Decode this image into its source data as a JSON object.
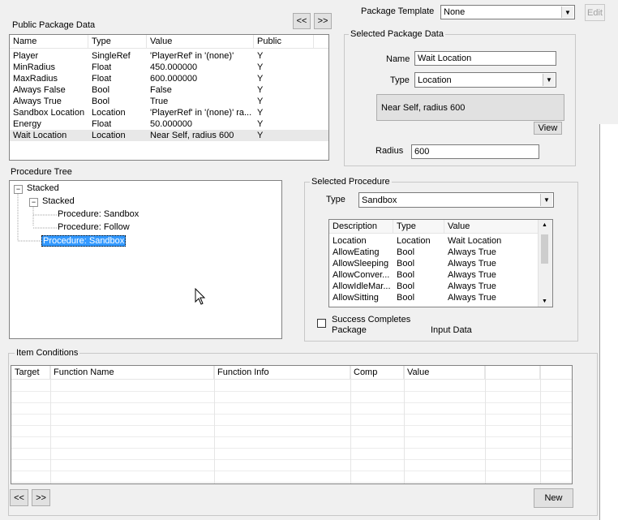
{
  "public_package": {
    "title": "Public Package Data",
    "nav_prev": "<<",
    "nav_next": ">>",
    "columns": [
      "Name",
      "Type",
      "Value",
      "Public"
    ],
    "rows": [
      [
        "Player",
        "SingleRef",
        "'PlayerRef' in '(none)'",
        "Y"
      ],
      [
        "MinRadius",
        "Float",
        "450.000000",
        "Y"
      ],
      [
        "MaxRadius",
        "Float",
        "600.000000",
        "Y"
      ],
      [
        "Always False",
        "Bool",
        "False",
        "Y"
      ],
      [
        "Always True",
        "Bool",
        "True",
        "Y"
      ],
      [
        "Sandbox Location",
        "Location",
        "'PlayerRef' in '(none)' ra...",
        "Y"
      ],
      [
        "Energy",
        "Float",
        "50.000000",
        "Y"
      ],
      [
        "Wait Location",
        "Location",
        "Near Self, radius 600",
        "Y"
      ]
    ],
    "selected_row": 7
  },
  "package_template": {
    "label": "Package Template",
    "value": "None",
    "edit_label": "Edit"
  },
  "selected_package": {
    "title": "Selected Package Data",
    "name_label": "Name",
    "name_value": "Wait Location",
    "type_label": "Type",
    "type_value": "Location",
    "location_text": "Near Self, radius 600",
    "view_label": "View",
    "radius_label": "Radius",
    "radius_value": "600"
  },
  "procedure_tree": {
    "title": "Procedure Tree",
    "root": "Stacked",
    "child": "Stacked",
    "leaf1": "Procedure: Sandbox",
    "leaf2": "Procedure: Follow",
    "leaf3": "Procedure: Sandbox"
  },
  "selected_procedure": {
    "title": "Selected Procedure",
    "type_label": "Type",
    "type_value": "Sandbox",
    "columns": [
      "Description",
      "Type",
      "Value"
    ],
    "rows": [
      [
        "Location",
        "Location",
        "Wait Location"
      ],
      [
        "AllowEating",
        "Bool",
        "Always True"
      ],
      [
        "AllowSleeping",
        "Bool",
        "Always True"
      ],
      [
        "AllowConver...",
        "Bool",
        "Always True"
      ],
      [
        "AllowIdleMar...",
        "Bool",
        "Always True"
      ],
      [
        "AllowSitting",
        "Bool",
        "Always True"
      ]
    ],
    "success_label_1": "Success Completes",
    "success_label_2": "Package",
    "input_data_label": "Input Data"
  },
  "item_conditions": {
    "title": "Item Conditions",
    "columns": [
      "Target",
      "Function Name",
      "Function Info",
      "Comp",
      "Value"
    ],
    "nav_prev": "<<",
    "nav_next": ">>",
    "new_label": "New"
  }
}
